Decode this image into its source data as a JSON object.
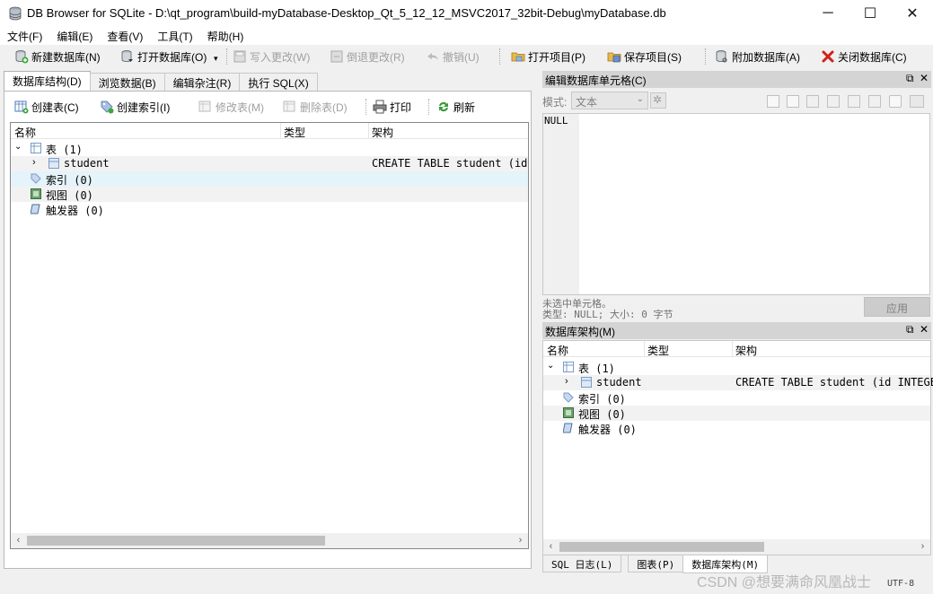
{
  "window": {
    "title": "DB Browser for SQLite - D:\\qt_program\\build-myDatabase-Desktop_Qt_5_12_12_MSVC2017_32bit-Debug\\myDatabase.db",
    "minimize": "─",
    "maximize": "☐",
    "close": "✕"
  },
  "menu": [
    "文件(F)",
    "编辑(E)",
    "查看(V)",
    "工具(T)",
    "帮助(H)"
  ],
  "toolbar": {
    "new_db": "新建数据库(N)",
    "open_db": "打开数据库(O)",
    "write_changes": "写入更改(W)",
    "revert_changes": "倒退更改(R)",
    "undo": "撤销(U)",
    "open_project": "打开项目(P)",
    "save_project": "保存项目(S)",
    "attach_db": "附加数据库(A)",
    "close_db": "关闭数据库(C)"
  },
  "left_tabs": [
    "数据库结构(D)",
    "浏览数据(B)",
    "编辑杂注(R)",
    "执行 SQL(X)"
  ],
  "structure_tools": {
    "create_table": "创建表(C)",
    "create_index": "创建索引(I)",
    "modify_table": "修改表(M)",
    "delete_table": "删除表(D)",
    "print": "打印",
    "refresh": "刷新"
  },
  "tree": {
    "headers": {
      "name": "名称",
      "type": "类型",
      "schema": "架构"
    },
    "tables_label": "表 (1)",
    "table_name": "student",
    "table_schema": "CREATE TABLE student (id",
    "indices_label": "索引 (0)",
    "views_label": "视图 (0)",
    "triggers_label": "触发器 (0)"
  },
  "cell_editor": {
    "title": "编辑数据库单元格(C)",
    "mode_label": "模式:",
    "mode_value": "文本",
    "content": "NULL",
    "status_line1": "未选中单元格。",
    "status_line2": "类型: NULL; 大小: 0 字节",
    "apply": "应用"
  },
  "schema_dock": {
    "title": "数据库架构(M)",
    "headers": {
      "name": "名称",
      "type": "类型",
      "schema": "架构"
    },
    "tables_label": "表 (1)",
    "table_name": "student",
    "table_schema": "CREATE TABLE student (id INTEGE",
    "indices_label": "索引 (0)",
    "views_label": "视图 (0)",
    "triggers_label": "触发器 (0)"
  },
  "bottom_tabs": [
    "SQL 日志(L)",
    "图表(P)",
    "数据库架构(M)"
  ],
  "status": {
    "encoding": "UTF-8"
  },
  "watermark": "CSDN @想要满命风凰战士",
  "colors": {
    "selection": "#e5f3fb",
    "dock_title": "#d4d4d4",
    "close_red": "#d0201a"
  }
}
